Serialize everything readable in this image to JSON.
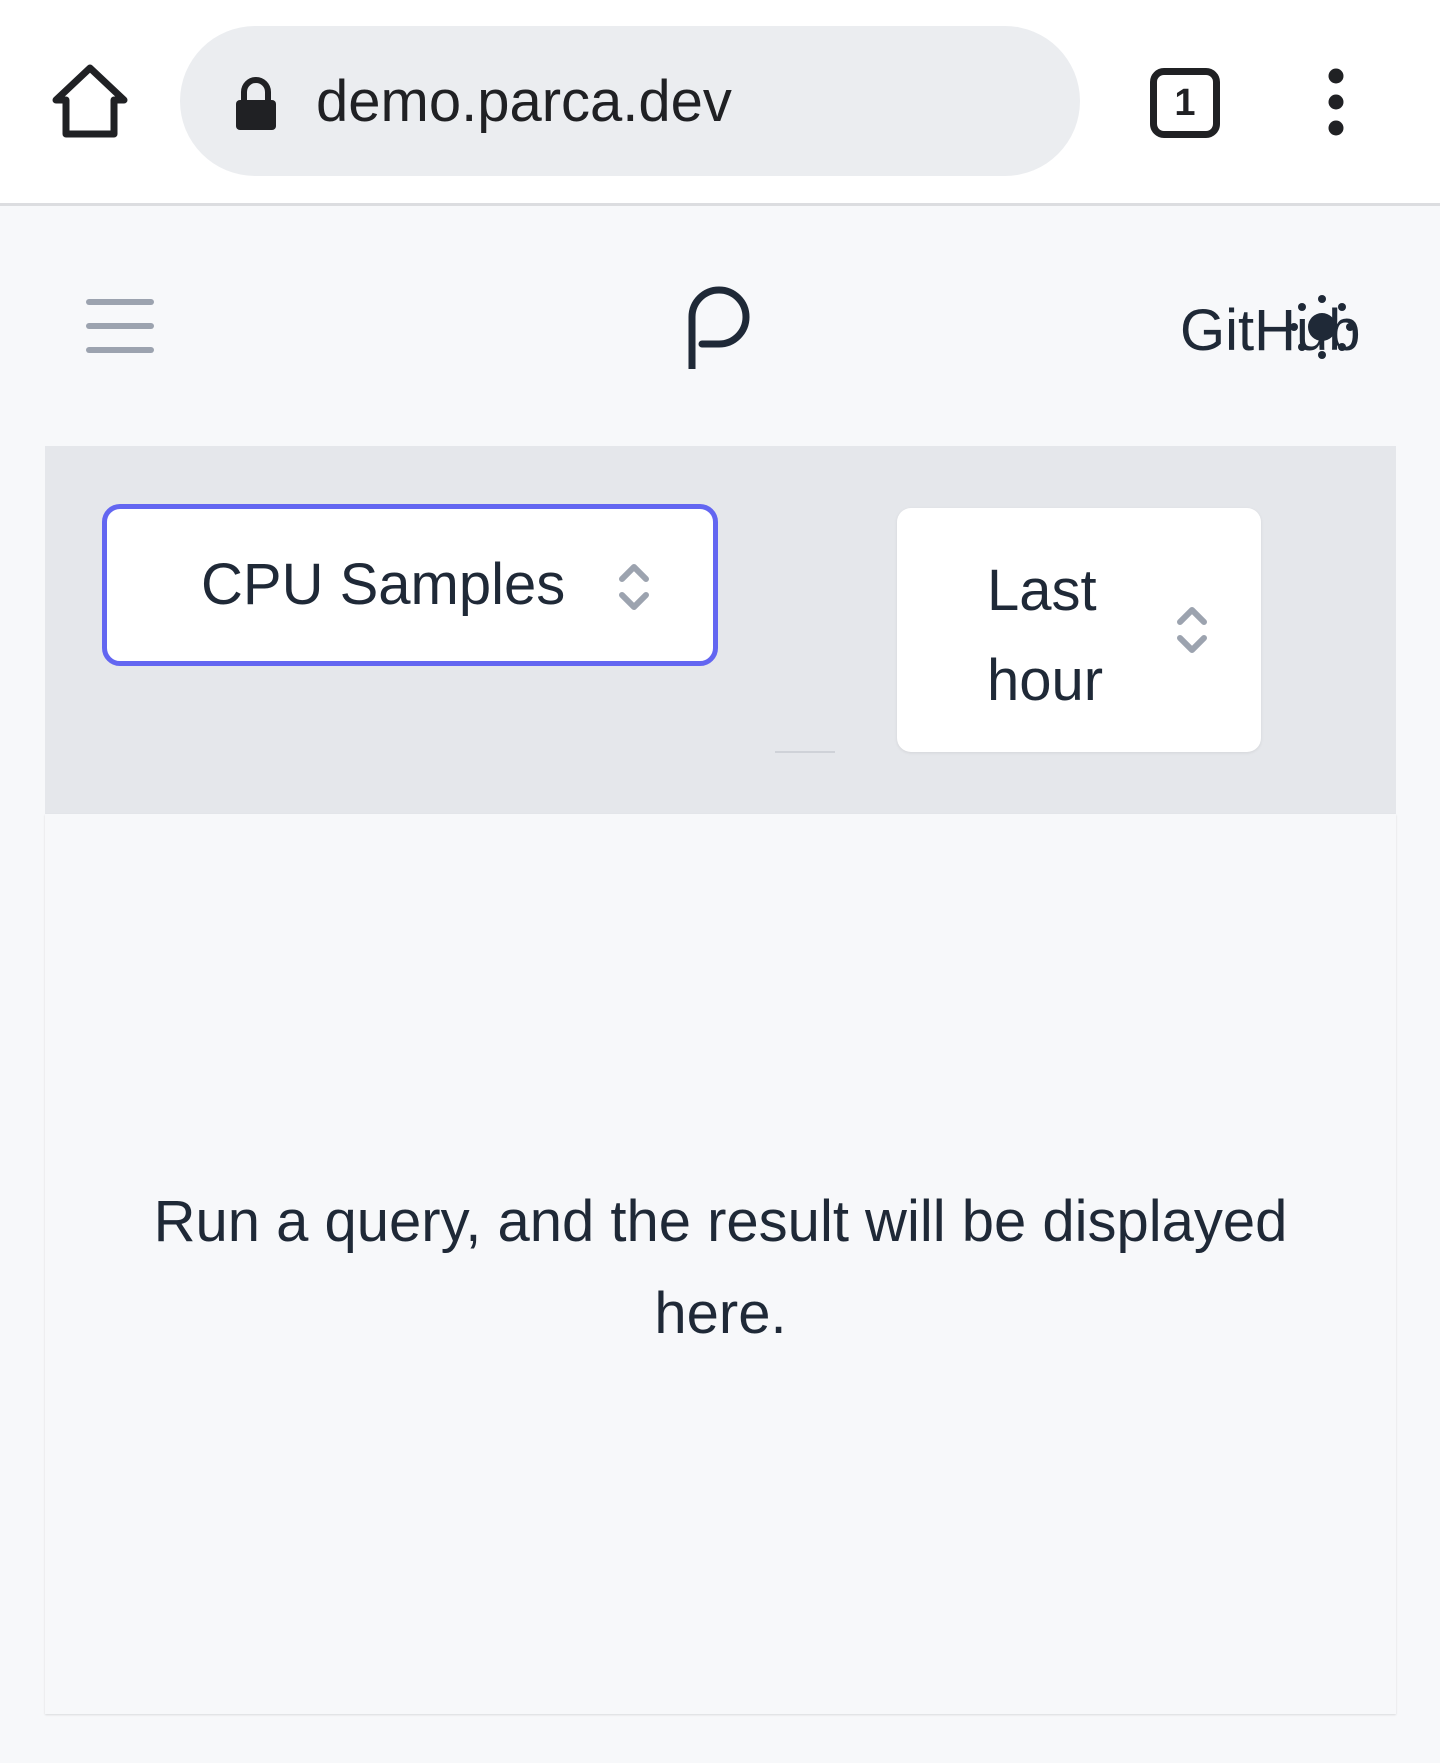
{
  "browser": {
    "url": "demo.parca.dev",
    "tab_count": "1"
  },
  "header": {
    "github_label": "GitHub"
  },
  "query": {
    "profile_type": "CPU Samples",
    "time_range": "Last hour"
  },
  "result": {
    "empty_message": "Run a query, and the result will be displayed here."
  },
  "colors": {
    "accent": "#6366f1",
    "panel": "#e5e7eb",
    "background": "#f7f8fa"
  }
}
